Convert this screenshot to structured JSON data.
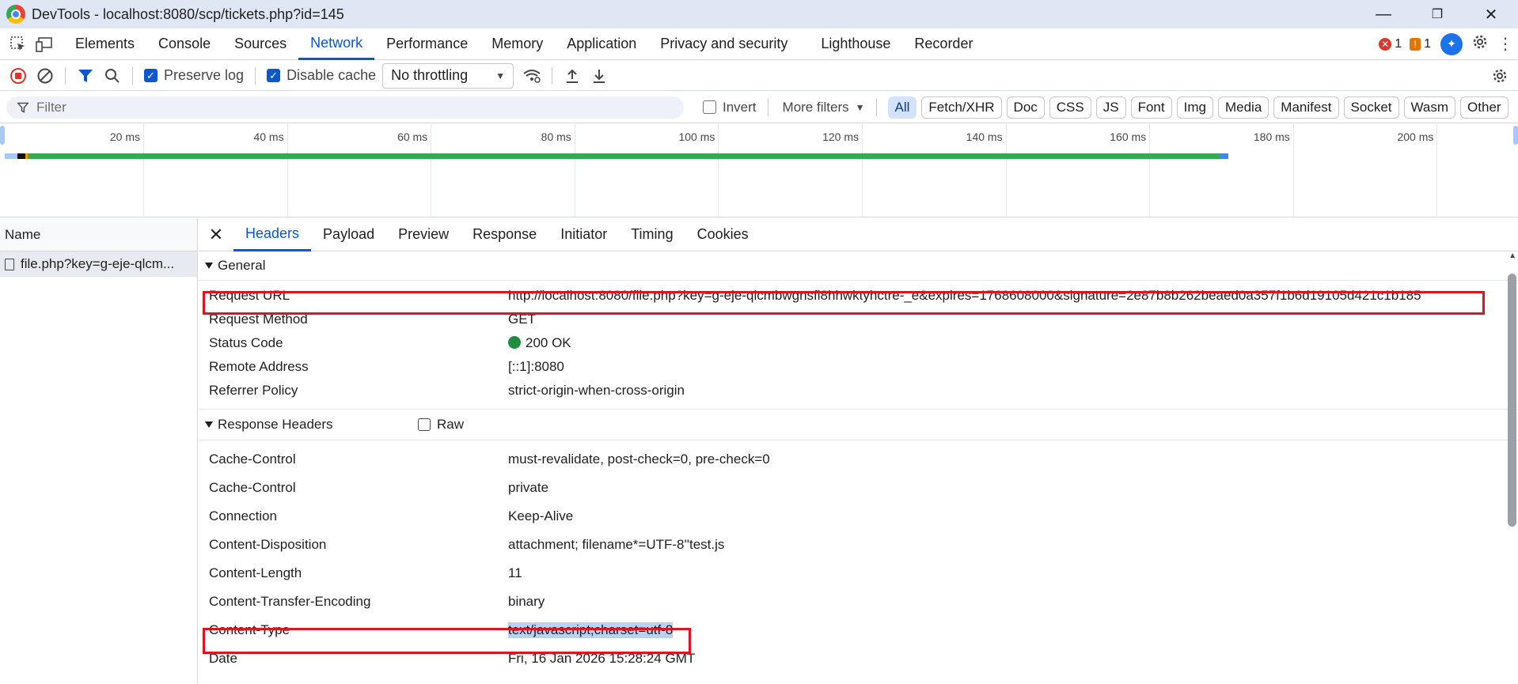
{
  "window": {
    "title": "DevTools - localhost:8080/scp/tickets.php?id=145",
    "minimize": "—",
    "restore": "❐",
    "close": "✕"
  },
  "tabs": [
    "Elements",
    "Console",
    "Sources",
    "Network",
    "Performance",
    "Memory",
    "Application",
    "Privacy and security",
    "Lighthouse",
    "Recorder"
  ],
  "active_tab": "Network",
  "counters": {
    "errors": "1",
    "warnings": "1"
  },
  "toolbar": {
    "preserve_log": "Preserve log",
    "disable_cache": "Disable cache",
    "throttling": "No throttling"
  },
  "filter": {
    "placeholder": "Filter",
    "invert": "Invert",
    "more_filters": "More filters",
    "chips": [
      "All",
      "Fetch/XHR",
      "Doc",
      "CSS",
      "JS",
      "Font",
      "Img",
      "Media",
      "Manifest",
      "Socket",
      "Wasm",
      "Other"
    ]
  },
  "timeline": {
    "ticks": [
      "20 ms",
      "40 ms",
      "60 ms",
      "80 ms",
      "100 ms",
      "120 ms",
      "140 ms",
      "160 ms",
      "180 ms",
      "200 ms"
    ]
  },
  "requests": {
    "header": "Name",
    "items": [
      "file.php?key=g-eje-qlcm..."
    ]
  },
  "detail_tabs": [
    "Headers",
    "Payload",
    "Preview",
    "Response",
    "Initiator",
    "Timing",
    "Cookies"
  ],
  "general": {
    "title": "General",
    "rows": [
      {
        "k": "Request URL",
        "v": "http://localhost:8080/file.php?key=g-eje-qlcmbwgnsfl8hhwktyhctre-_e&expires=1768608000&signature=2e87b8b262beaed0a357f1b6d19105d421c1b185"
      },
      {
        "k": "Request Method",
        "v": "GET"
      },
      {
        "k": "Status Code",
        "v": "200 OK"
      },
      {
        "k": "Remote Address",
        "v": "[::1]:8080"
      },
      {
        "k": "Referrer Policy",
        "v": "strict-origin-when-cross-origin"
      }
    ]
  },
  "response_headers": {
    "title": "Response Headers",
    "raw": "Raw",
    "rows": [
      {
        "k": "Cache-Control",
        "v": "must-revalidate, post-check=0, pre-check=0"
      },
      {
        "k": "Cache-Control",
        "v": "private"
      },
      {
        "k": "Connection",
        "v": "Keep-Alive"
      },
      {
        "k": "Content-Disposition",
        "v": "attachment; filename*=UTF-8''test.js"
      },
      {
        "k": "Content-Length",
        "v": "11"
      },
      {
        "k": "Content-Transfer-Encoding",
        "v": "binary"
      },
      {
        "k": "Content-Type",
        "v": "text/javascript;charset=utf-8"
      },
      {
        "k": "Date",
        "v": "Fri, 16 Jan 2026 15:28:24 GMT"
      }
    ]
  },
  "colors": {
    "accent": "#0b57d0",
    "highlight": "#e0131f",
    "status_ok": "#1e8e3e"
  }
}
